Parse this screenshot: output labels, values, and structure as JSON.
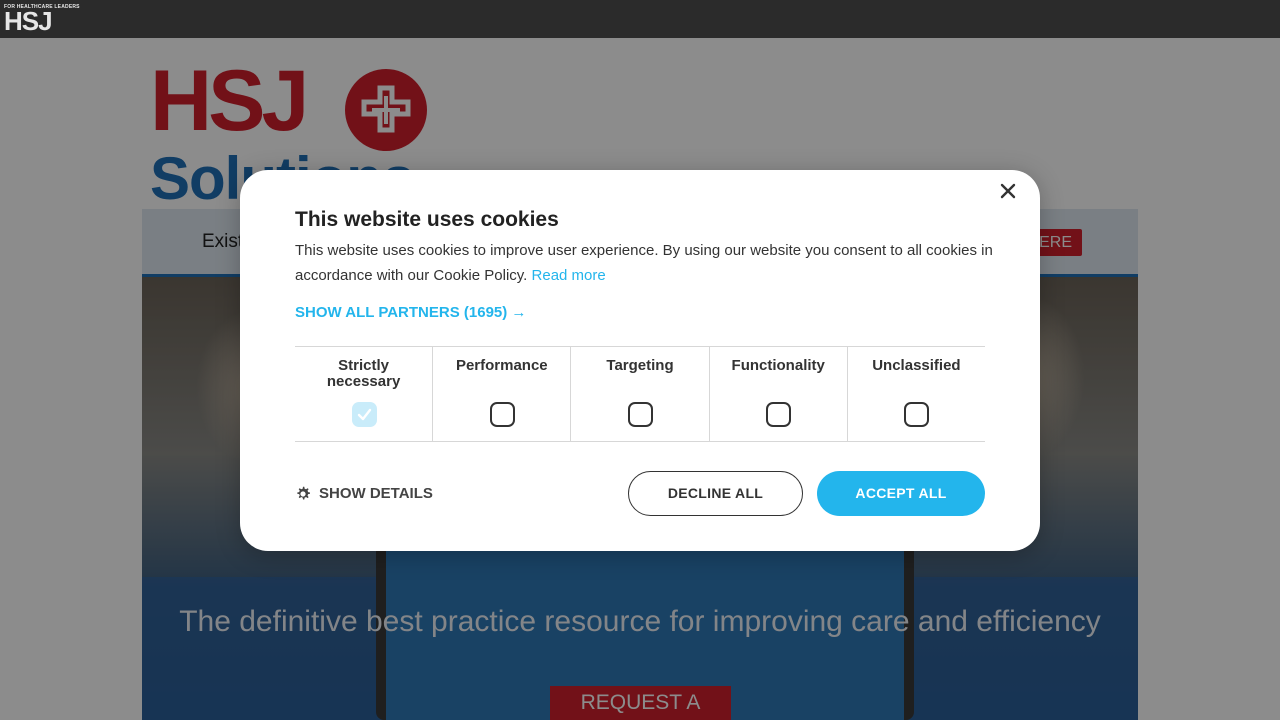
{
  "topbar": {
    "logo_tagline": "FOR HEALTHCARE LEADERS",
    "logo_mark": "HSJ"
  },
  "brand": {
    "primary": "HSJ",
    "secondary": "Solutions",
    "colors": {
      "red": "#d0202c",
      "blue": "#1f6fb6"
    }
  },
  "nav": {
    "existing_text": "Exist",
    "here_button": "HERE"
  },
  "hero": {
    "title": "The definitive best practice resource for improving care and efficiency",
    "cta": "REQUEST A DEMO"
  },
  "cookie_modal": {
    "title": "This website uses cookies",
    "text": "This website uses cookies to improve user experience. By using our website you consent to all cookies in accordance with our Cookie Policy.",
    "read_more": "Read more",
    "show_partners": "SHOW ALL PARTNERS (1695) →",
    "categories": [
      {
        "label": "Strictly necessary",
        "checked": true
      },
      {
        "label": "Performance",
        "checked": false
      },
      {
        "label": "Targeting",
        "checked": false
      },
      {
        "label": "Functionality",
        "checked": false
      },
      {
        "label": "Unclassified",
        "checked": false
      }
    ],
    "show_details": "SHOW DETAILS",
    "decline_all": "DECLINE ALL",
    "accept_all": "ACCEPT ALL",
    "accent_color": "#23b5ec",
    "icons": {
      "close": "close-icon",
      "details": "gear-icon",
      "checked": "checkmark-icon"
    }
  }
}
